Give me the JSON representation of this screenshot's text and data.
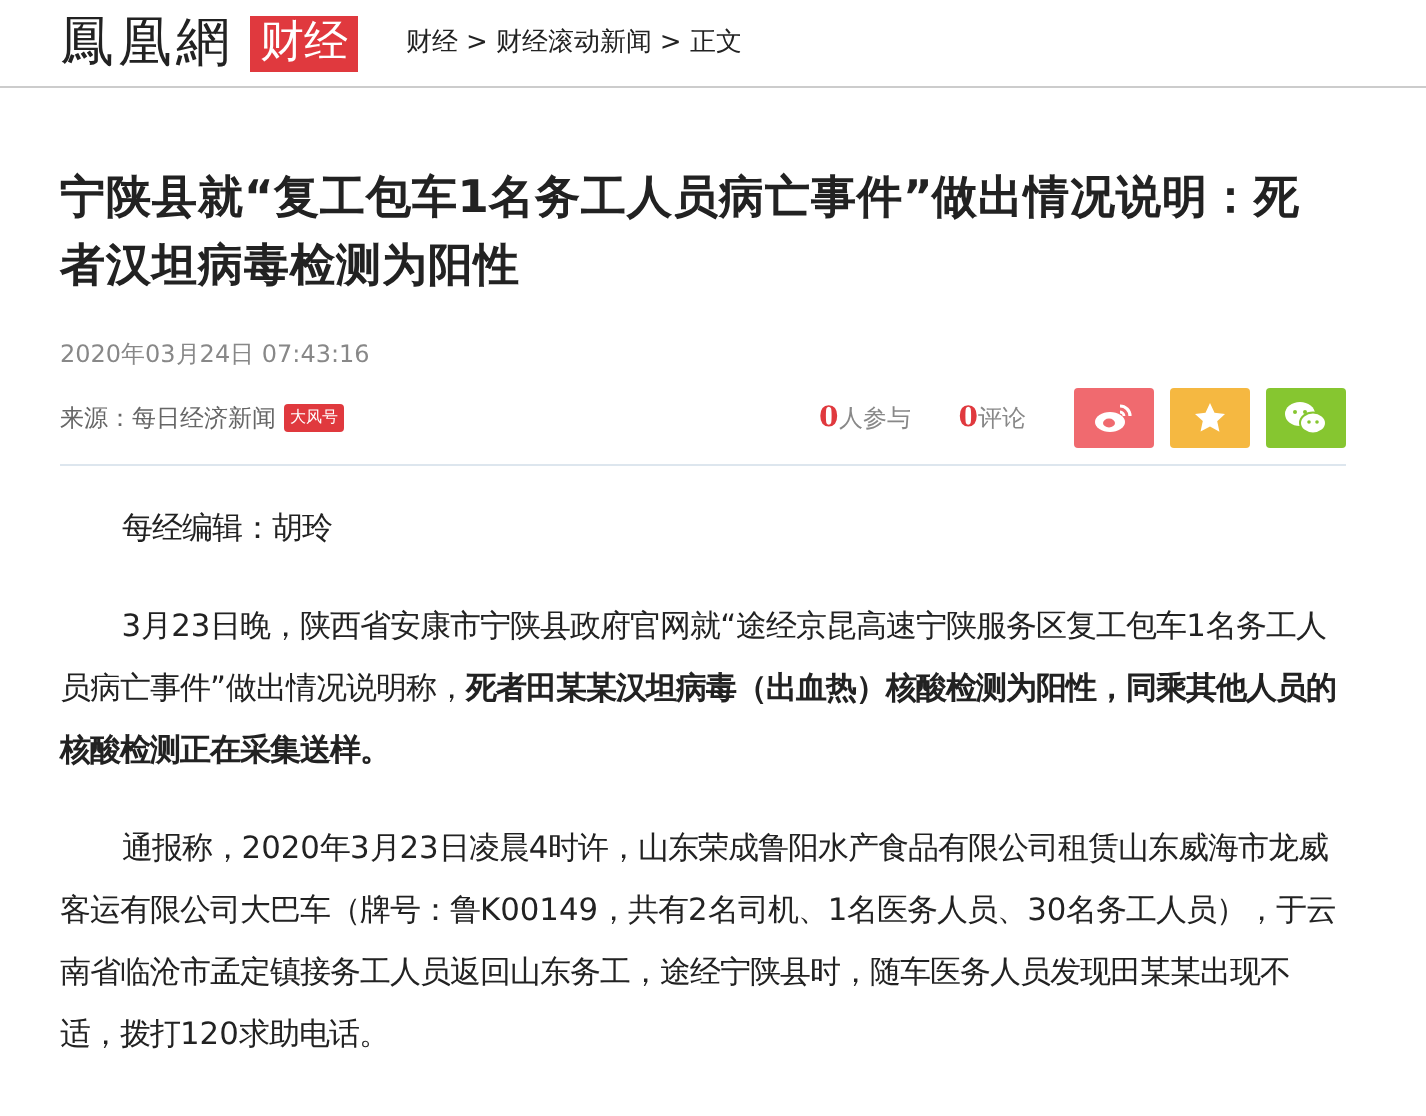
{
  "header": {
    "logo": "鳳凰網",
    "channel": "财经",
    "breadcrumb": [
      "财经",
      ">",
      "财经滚动新闻",
      ">",
      "正文"
    ]
  },
  "article": {
    "title": "宁陕县就“复工包车1名务工人员病亡事件”做出情况说明：死者汉坦病毒检测为阳性",
    "date": "2020年03月24日 07:43:16",
    "source": "来源：每日经济新闻",
    "source_tag": "大风号",
    "stats": [
      {
        "count": "0",
        "label": "人参与"
      },
      {
        "count": "0",
        "label": "评论"
      }
    ],
    "share": [
      {
        "kind": "weibo",
        "color": "#f06a6f"
      },
      {
        "kind": "favorite",
        "color": "#f5b841"
      },
      {
        "kind": "wechat",
        "color": "#86c630"
      }
    ],
    "paragraphs": [
      "每经编辑：胡玲",
      "3月23日晚，陕西省安康市宁陕县政府官网就“途经京昆高速宁陕服务区复工包车1名务工人员病亡事件”做出情况说明称，**死者田某某汉坦病毒（出血热）核酸检测为阳性，同乘其他人员的核酸检测正在采集送样。**",
      "通报称，2020年3月23日凌晨4时许，山东荣成鲁阳水产食品有限公司租赁山东威海市龙威客运有限公司大巴车（牌号：鲁K00149，共有2名司机、1名医务人员、30名务工人员），于云南省临沧市孟定镇接务工人员返回山东务工，途经宁陕县时，随车医务人员发现田某某出现不适，拨打120求助电话。"
    ]
  }
}
